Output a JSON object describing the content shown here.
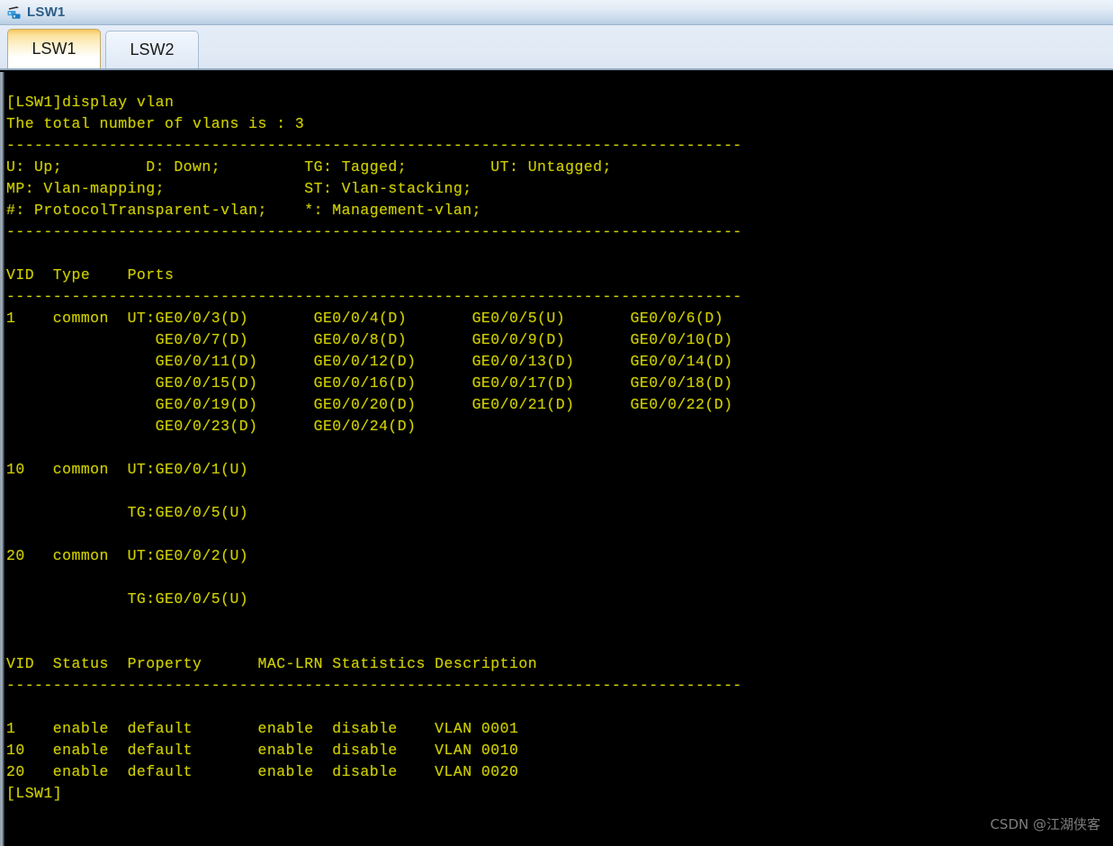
{
  "window": {
    "title": "LSW1",
    "icon": "switch-icon"
  },
  "tabs": [
    {
      "label": "LSW1",
      "active": true
    },
    {
      "label": "LSW2",
      "active": false
    }
  ],
  "terminal": {
    "prompt": "[LSW1]",
    "command": "display vlan",
    "foreground_color": "#cfcf00",
    "background_color": "#000000",
    "lines": [
      "[LSW1]display vlan",
      "The total number of vlans is : 3",
      "-------------------------------------------------------------------------------",
      "U: Up;         D: Down;         TG: Tagged;         UT: Untagged;",
      "MP: Vlan-mapping;               ST: Vlan-stacking;",
      "#: ProtocolTransparent-vlan;    *: Management-vlan;",
      "-------------------------------------------------------------------------------",
      "",
      "VID  Type    Ports",
      "-------------------------------------------------------------------------------",
      "1    common  UT:GE0/0/3(D)       GE0/0/4(D)       GE0/0/5(U)       GE0/0/6(D)",
      "                GE0/0/7(D)       GE0/0/8(D)       GE0/0/9(D)       GE0/0/10(D)",
      "                GE0/0/11(D)      GE0/0/12(D)      GE0/0/13(D)      GE0/0/14(D)",
      "                GE0/0/15(D)      GE0/0/16(D)      GE0/0/17(D)      GE0/0/18(D)",
      "                GE0/0/19(D)      GE0/0/20(D)      GE0/0/21(D)      GE0/0/22(D)",
      "                GE0/0/23(D)      GE0/0/24(D)",
      "",
      "10   common  UT:GE0/0/1(U)",
      "",
      "             TG:GE0/0/5(U)",
      "",
      "20   common  UT:GE0/0/2(U)",
      "",
      "             TG:GE0/0/5(U)",
      "",
      "",
      "VID  Status  Property      MAC-LRN Statistics Description",
      "-------------------------------------------------------------------------------",
      "",
      "1    enable  default       enable  disable    VLAN 0001",
      "10   enable  default       enable  disable    VLAN 0010",
      "20   enable  default       enable  disable    VLAN 0020",
      "[LSW1]"
    ],
    "vlan_summary": {
      "total_vlans": 3,
      "legend": [
        {
          "code": "U",
          "meaning": "Up"
        },
        {
          "code": "D",
          "meaning": "Down"
        },
        {
          "code": "TG",
          "meaning": "Tagged"
        },
        {
          "code": "UT",
          "meaning": "Untagged"
        },
        {
          "code": "MP",
          "meaning": "Vlan-mapping"
        },
        {
          "code": "ST",
          "meaning": "Vlan-stacking"
        },
        {
          "code": "#",
          "meaning": "ProtocolTransparent-vlan"
        },
        {
          "code": "*",
          "meaning": "Management-vlan"
        }
      ],
      "ports_table": {
        "headers": [
          "VID",
          "Type",
          "Ports"
        ],
        "rows": [
          {
            "vid": "1",
            "type": "common",
            "untagged": [
              "GE0/0/3(D)",
              "GE0/0/4(D)",
              "GE0/0/5(U)",
              "GE0/0/6(D)",
              "GE0/0/7(D)",
              "GE0/0/8(D)",
              "GE0/0/9(D)",
              "GE0/0/10(D)",
              "GE0/0/11(D)",
              "GE0/0/12(D)",
              "GE0/0/13(D)",
              "GE0/0/14(D)",
              "GE0/0/15(D)",
              "GE0/0/16(D)",
              "GE0/0/17(D)",
              "GE0/0/18(D)",
              "GE0/0/19(D)",
              "GE0/0/20(D)",
              "GE0/0/21(D)",
              "GE0/0/22(D)",
              "GE0/0/23(D)",
              "GE0/0/24(D)"
            ],
            "tagged": []
          },
          {
            "vid": "10",
            "type": "common",
            "untagged": [
              "GE0/0/1(U)"
            ],
            "tagged": [
              "GE0/0/5(U)"
            ]
          },
          {
            "vid": "20",
            "type": "common",
            "untagged": [
              "GE0/0/2(U)"
            ],
            "tagged": [
              "GE0/0/5(U)"
            ]
          }
        ]
      },
      "status_table": {
        "headers": [
          "VID",
          "Status",
          "Property",
          "MAC-LRN",
          "Statistics",
          "Description"
        ],
        "rows": [
          [
            "1",
            "enable",
            "default",
            "enable",
            "disable",
            "VLAN 0001"
          ],
          [
            "10",
            "enable",
            "default",
            "enable",
            "disable",
            "VLAN 0010"
          ],
          [
            "20",
            "enable",
            "default",
            "enable",
            "disable",
            "VLAN 0020"
          ]
        ]
      }
    }
  },
  "watermark": {
    "text": "CSDN @江湖侠客"
  }
}
